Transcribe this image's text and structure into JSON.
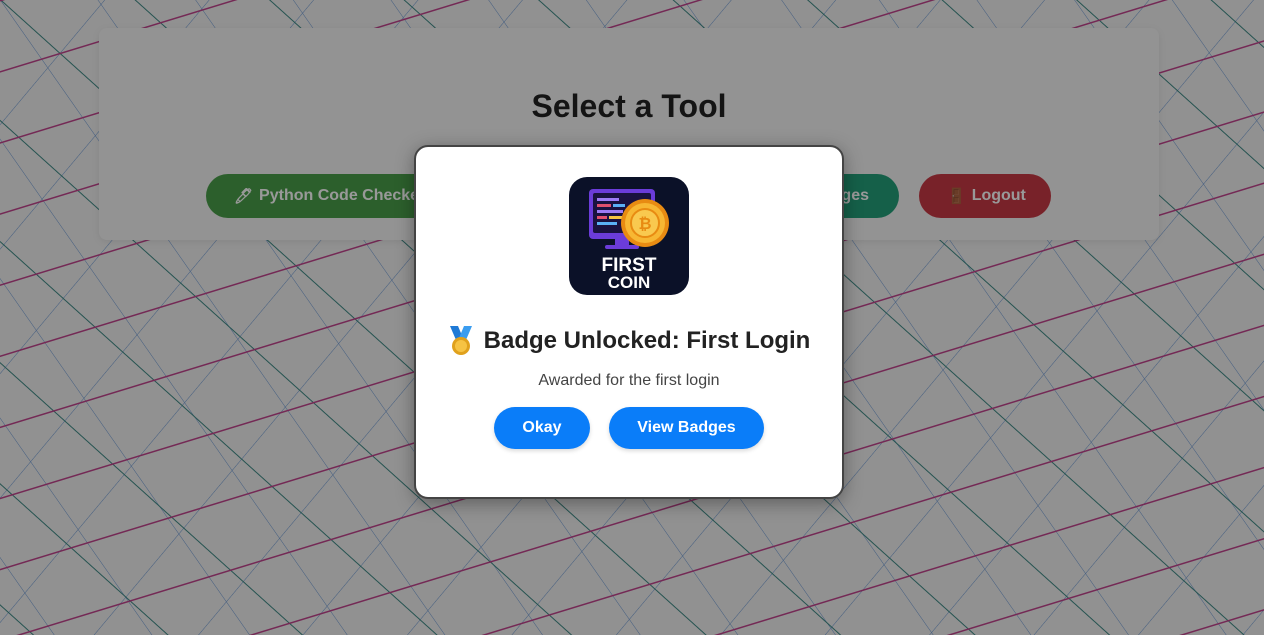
{
  "page": {
    "title": "Select a Tool"
  },
  "tools": {
    "python_label": "Python Code Checker",
    "python_icon": "pen-icon",
    "badges_label": "Badges",
    "logout_label": "Logout",
    "logout_icon": "door-icon"
  },
  "modal": {
    "badge_image_text_1": "FIRST",
    "badge_image_text_2": "COIN",
    "title": "Badge Unlocked: First Login",
    "icon": "medal-icon",
    "description": "Awarded for the first login",
    "okay_label": "Okay",
    "view_badges_label": "View Badges"
  },
  "colors": {
    "python_button": "#4a9f4a",
    "badges_button": "#23a07a",
    "logout_button": "#c83a45",
    "modal_button": "#0a7df9"
  }
}
